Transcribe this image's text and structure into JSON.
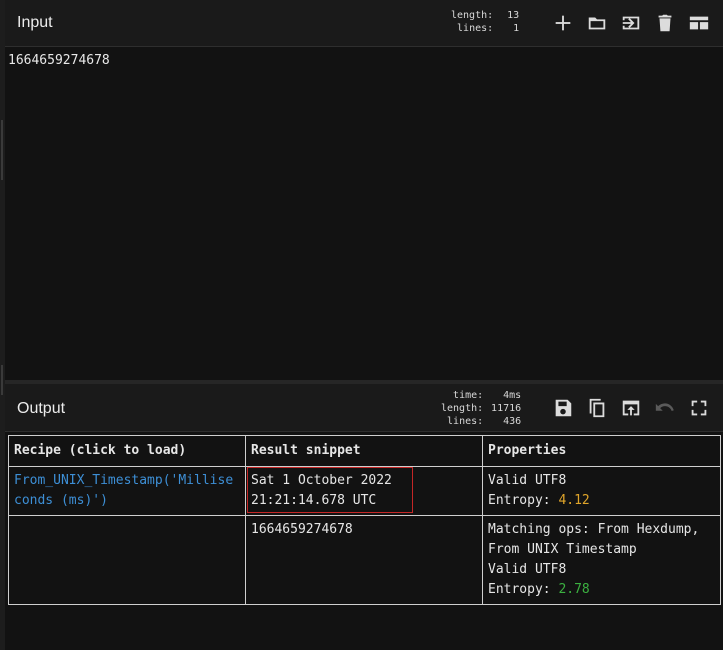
{
  "input": {
    "title": "Input",
    "stats": {
      "length_label": "length:",
      "length": "13",
      "lines_label": "lines:",
      "lines": "1"
    },
    "text": "1664659274678",
    "icons": [
      "plus-icon",
      "folder-icon",
      "import-icon",
      "trash-icon",
      "layout-icon"
    ]
  },
  "output": {
    "title": "Output",
    "stats": {
      "time_label": "time:",
      "time": "4ms",
      "length_label": "length:",
      "length": "11716",
      "lines_label": "lines:",
      "lines": "436"
    },
    "icons": [
      "save-icon",
      "copy-icon",
      "replace-input-icon",
      "undo-icon",
      "fullscreen-icon"
    ]
  },
  "results": {
    "headers": [
      "Recipe (click to load)",
      "Result snippet",
      "Properties"
    ],
    "rows": [
      {
        "recipe": "From_UNIX_Timestamp('Milliseconds (ms)')",
        "snippet_line1": "Sat 1 October 2022",
        "snippet_line2": "21:21:14.678 UTC",
        "prop_line1": "Valid UTF8",
        "entropy_label": "Entropy: ",
        "entropy": "4.12"
      },
      {
        "recipe": "",
        "snippet_line1": "1664659274678",
        "prop_matching": "Matching ops: From Hexdump, From UNIX Timestamp",
        "prop_line1": "Valid UTF8",
        "entropy_label": "Entropy: ",
        "entropy": "2.78"
      }
    ]
  },
  "colors": {
    "background": "#111111",
    "recipe_link": "#3d8fd6",
    "entropy_high": "#e0a52a",
    "entropy_low": "#3bb040",
    "highlight": "#c42626"
  }
}
